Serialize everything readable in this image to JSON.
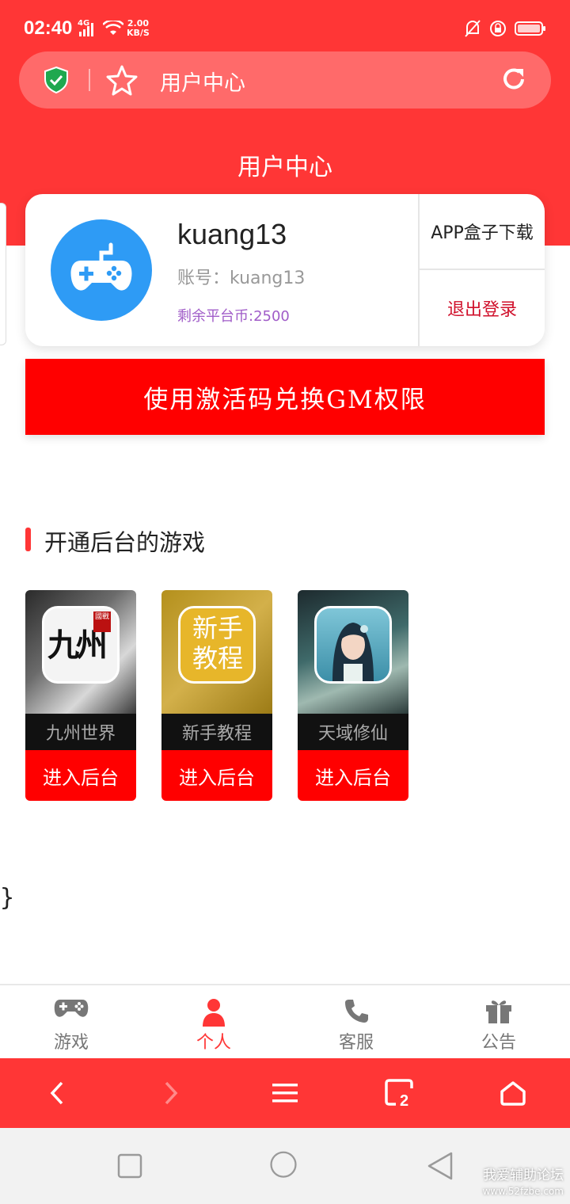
{
  "status_bar": {
    "time": "02:40",
    "network": "4G",
    "speed_value": "2.00",
    "speed_unit": "KB/S"
  },
  "url_bar": {
    "title": "用户中心"
  },
  "header": {
    "title": "用户中心"
  },
  "user_card": {
    "username": "kuang13",
    "account": "账号：kuang13",
    "coins": "剩余平台币:2500",
    "app_download": "APP盒子下载",
    "logout": "退出登录"
  },
  "gm_button": "使用激活码兑换GM权限",
  "section_title": "开通后台的游戏",
  "games": [
    {
      "name": "九州世界",
      "action": "进入后台",
      "icon_text_main": "九州",
      "icon_text_badge": "國戰"
    },
    {
      "name": "新手教程",
      "action": "进入后台",
      "icon_text_main": "新手教程"
    },
    {
      "name": "天域修仙",
      "action": "进入后台"
    }
  ],
  "stray_text": "}",
  "tab_bar": [
    {
      "label": "游戏",
      "icon": "gamepad-icon"
    },
    {
      "label": "个人",
      "icon": "person-icon",
      "active": true
    },
    {
      "label": "客服",
      "icon": "phone-icon"
    },
    {
      "label": "公告",
      "icon": "gift-icon"
    }
  ],
  "browser_nav": {
    "tab_count": "2"
  },
  "watermark": {
    "line1": "我爱辅助论坛",
    "line2": "www.52fzbe.com"
  },
  "colors": {
    "brand_red": "#ff3636",
    "button_red": "#ff0000",
    "avatar_blue": "#2e9bf5",
    "coins_purple": "#a05cc8",
    "logout_red": "#d0102b"
  }
}
